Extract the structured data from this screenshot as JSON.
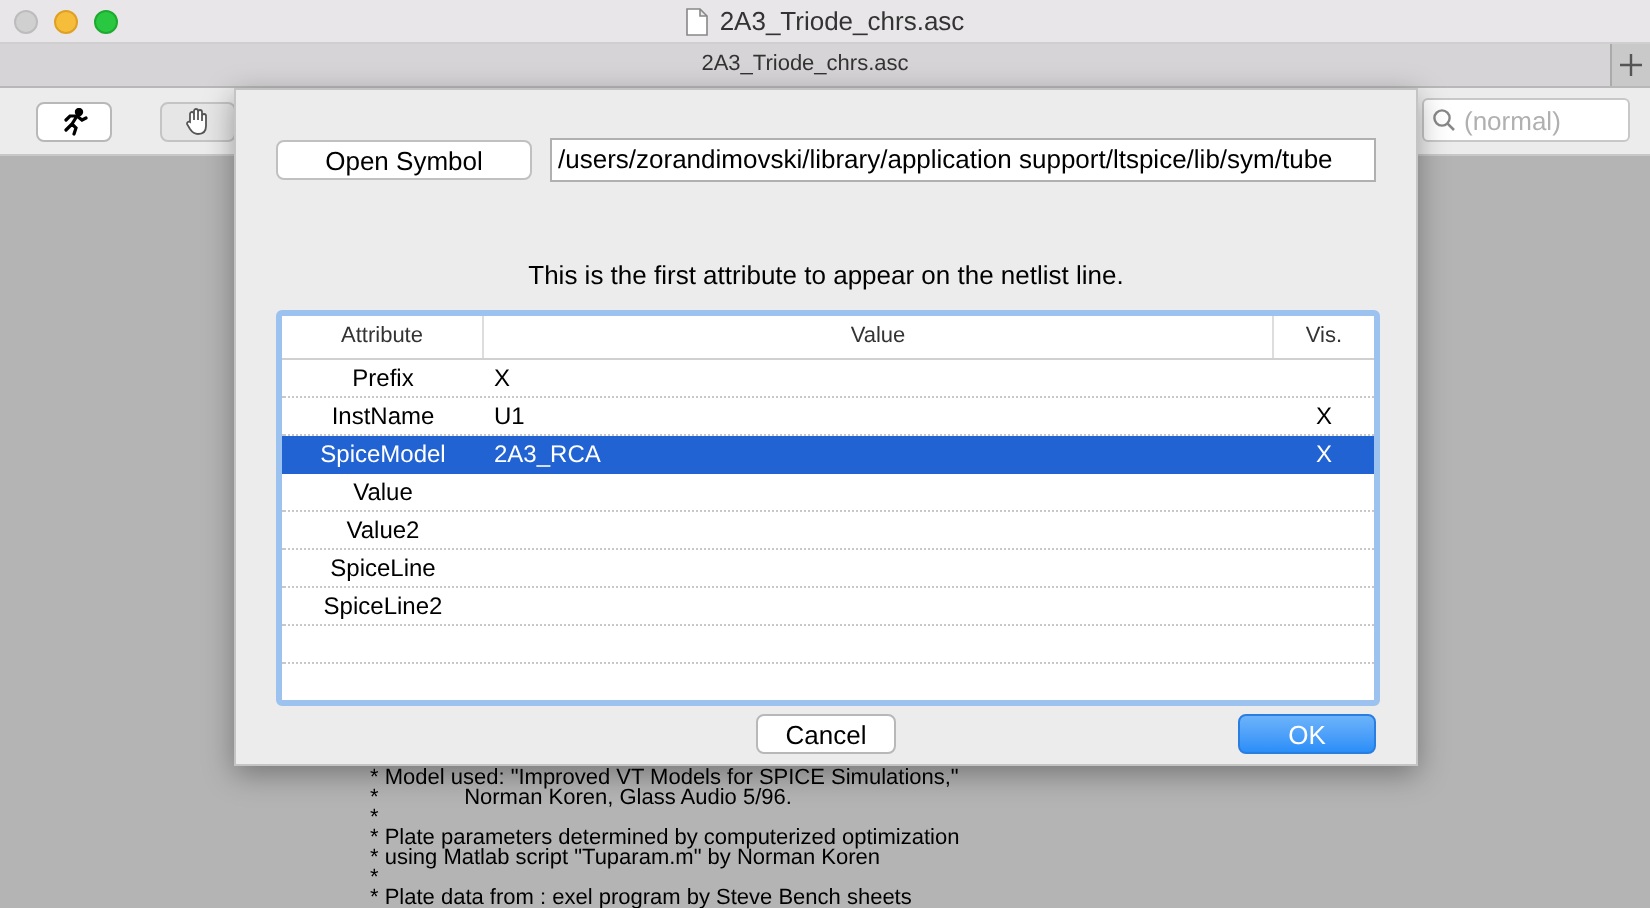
{
  "window": {
    "title": "2A3_Triode_chrs.asc"
  },
  "tabs": [
    {
      "label": "2A3_Triode_chrs.asc",
      "selected": true
    }
  ],
  "toolbar": {
    "search": {
      "placeholder": "(normal)"
    }
  },
  "dialog": {
    "open_symbol_button": "Open Symbol",
    "symbol_path": "/users/zorandimovski/library/application support/ltspice/lib/sym/tube",
    "hint": "This is the first attribute to appear on the netlist line.",
    "table": {
      "columns": [
        "Attribute",
        "Value",
        "Vis."
      ],
      "rows": [
        {
          "attribute": "Prefix",
          "value": "X",
          "vis": "",
          "selected": false
        },
        {
          "attribute": "InstName",
          "value": "U1",
          "vis": "X",
          "selected": false
        },
        {
          "attribute": "SpiceModel",
          "value": "2A3_RCA",
          "vis": "X",
          "selected": true
        },
        {
          "attribute": "Value",
          "value": "",
          "vis": "",
          "selected": false
        },
        {
          "attribute": "Value2",
          "value": "",
          "vis": "",
          "selected": false
        },
        {
          "attribute": "SpiceLine",
          "value": "",
          "vis": "",
          "selected": false
        },
        {
          "attribute": "SpiceLine2",
          "value": "",
          "vis": "",
          "selected": false
        }
      ]
    },
    "buttons": [
      {
        "label": "Cancel",
        "kind": "secondary"
      },
      {
        "label": "OK",
        "kind": "primary"
      }
    ]
  },
  "canvas_text": [
    "* Model used: \"Improved VT Models for SPICE Simulations,\"",
    "*              Norman Koren, Glass Audio 5/96.",
    "*",
    "* Plate parameters determined by computerized optimization",
    "* using Matlab script \"Tuparam.m\" by Norman Koren",
    "*",
    "* Plate data from : exel program by Steve Bench sheets"
  ]
}
